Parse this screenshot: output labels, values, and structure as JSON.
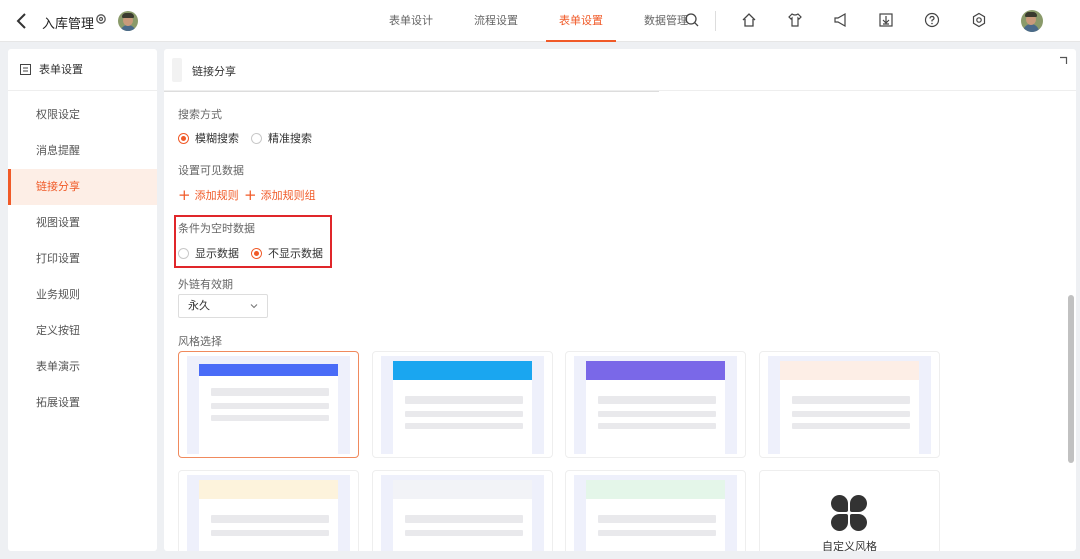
{
  "header": {
    "app_title": "入库管理",
    "tabs": [
      {
        "label": "表单设计",
        "active": false
      },
      {
        "label": "流程设置",
        "active": false
      },
      {
        "label": "表单设置",
        "active": true
      },
      {
        "label": "数据管理",
        "active": false
      }
    ],
    "icons": [
      "search-icon",
      "home-icon",
      "tshirt-icon",
      "megaphone-icon",
      "download-icon",
      "help-icon",
      "settings-icon"
    ]
  },
  "sidebar": {
    "title": "表单设置",
    "items": [
      {
        "label": "权限设定",
        "active": false
      },
      {
        "label": "消息提醒",
        "active": false
      },
      {
        "label": "链接分享",
        "active": true
      },
      {
        "label": "视图设置",
        "active": false
      },
      {
        "label": "打印设置",
        "active": false
      },
      {
        "label": "业务规则",
        "active": false
      },
      {
        "label": "定义按钮",
        "active": false
      },
      {
        "label": "表单演示",
        "active": false
      },
      {
        "label": "拓展设置",
        "active": false
      }
    ]
  },
  "main": {
    "title": "链接分享",
    "search_mode": {
      "label": "搜索方式",
      "options": [
        {
          "label": "模糊搜索",
          "checked": true
        },
        {
          "label": "精准搜索",
          "checked": false
        }
      ]
    },
    "visible_data": {
      "label": "设置可见数据",
      "add_rule": "添加规则",
      "add_rule_group": "添加规则组"
    },
    "empty_condition": {
      "label": "条件为空时数据",
      "options": [
        {
          "label": "显示数据",
          "checked": false
        },
        {
          "label": "不显示数据",
          "checked": true
        }
      ]
    },
    "validity": {
      "label": "外链有效期",
      "value": "永久"
    },
    "style": {
      "label": "风格选择",
      "custom_label": "自定义风格"
    }
  },
  "colors": {
    "accent": "#f05a28",
    "highlight": "#e0262a"
  }
}
